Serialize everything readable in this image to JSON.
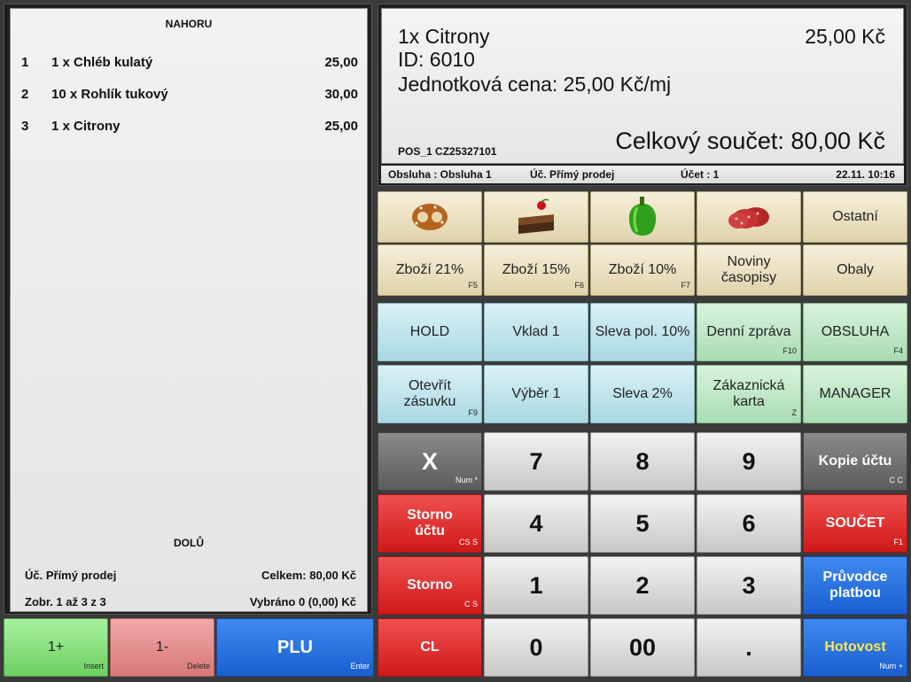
{
  "receipt": {
    "scroll_up": "NAHORU",
    "scroll_down": "DOLŮ",
    "items": [
      {
        "num": "1",
        "qty": "1 x  Chléb kulatý",
        "price": "25,00"
      },
      {
        "num": "2",
        "qty": "10 x  Rohlík tukový",
        "price": "30,00"
      },
      {
        "num": "3",
        "qty": "1 x  Citrony",
        "price": "25,00"
      }
    ],
    "account_type": "Úč.  Přímý prodej",
    "total": "Celkem: 80,00 Kč",
    "view": "Zobr.  1 až 3 z 3",
    "selected": "Vybráno 0 (0,00) Kč"
  },
  "display": {
    "line1": "1x  Citrony",
    "price": "25,00 Kč",
    "line2": "ID: 6010",
    "line3": "Jednotková cena: 25,00 Kč/mj",
    "pos": "POS_1 CZ25327101",
    "total": "Celkový součet: 80,00 Kč"
  },
  "status": {
    "operator": "Obsluha : Obsluha 1",
    "account": "Úč. Přímý prodej",
    "bill": "Účet : 1",
    "datetime": "22.11. 10:16"
  },
  "categories": {
    "other": "Ostatní",
    "goods21": "Zboží 21%",
    "goods21_key": "F5",
    "goods15": "Zboží 15%",
    "goods15_key": "F6",
    "goods10": "Zboží 10%",
    "goods10_key": "F7",
    "news1": "Noviny",
    "news2": "časopisy",
    "packaging": "Obaly"
  },
  "functions": {
    "hold": "HOLD",
    "deposit": "Vklad 1",
    "discount_item": "Sleva pol. 10%",
    "daily_report": "Denní zpráva",
    "daily_report_key": "F10",
    "operator": "OBSLUHA",
    "operator_key": "F4",
    "open_drawer1": "Otevřít",
    "open_drawer2": "zásuvku",
    "open_drawer_key": "F9",
    "withdraw": "Výběr 1",
    "discount": "Sleva 2%",
    "customer_card1": "Zákaznická",
    "customer_card2": "karta",
    "customer_card_key": "Z",
    "manager": "MANAGER"
  },
  "keypad": {
    "x": "X",
    "x_key": "Num *",
    "seven": "7",
    "eight": "8",
    "nine": "9",
    "copy": "Kopie účtu",
    "copy_key": "C C",
    "storno_bill1": "Storno",
    "storno_bill2": "účtu",
    "storno_bill_key": "CS S",
    "four": "4",
    "five": "5",
    "six": "6",
    "sum": "SOUČET",
    "sum_key": "F1",
    "storno": "Storno",
    "storno_key": "C S",
    "one": "1",
    "two": "2",
    "three": "3",
    "payment1": "Průvodce",
    "payment2": "platbou",
    "cl": "CL",
    "zero": "0",
    "double_zero": "00",
    "dot": ".",
    "cash": "Hotovost",
    "cash_key": "Num +"
  },
  "bottom": {
    "plus": "1+",
    "plus_key": "Insert",
    "minus": "1-",
    "minus_key": "Delete",
    "plu": "PLU",
    "plu_key": "Enter"
  },
  "colors": {
    "tan": "#e0d3ac",
    "cyan": "#aad8e2",
    "mint": "#a9dcb3",
    "red": "#d01818",
    "blue": "#1a5fd0",
    "green": "#6cd060"
  }
}
